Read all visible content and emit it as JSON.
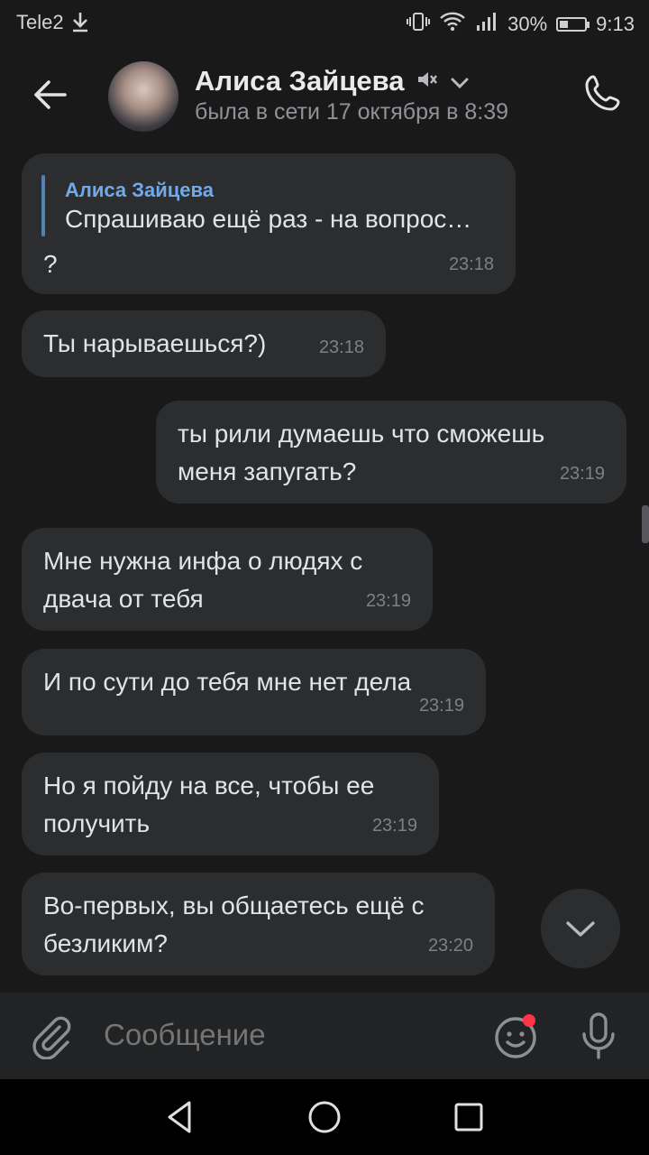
{
  "status_bar": {
    "carrier": "Tele2",
    "battery": "30%",
    "time": "9:13"
  },
  "header": {
    "name": "Алиса Зайцева",
    "status": "была в сети 17 октября в 8:39",
    "icons": [
      "back-arrow-icon",
      "muted-icon",
      "chevron-down-icon",
      "phone-icon"
    ]
  },
  "messages": [
    {
      "reply": {
        "author": "Алиса Зайцева",
        "text": "Спрашиваю ещё раз - на вопрос…"
      },
      "text": "?",
      "time": "23:18",
      "outgoing": false
    },
    {
      "text": "Ты нарываешься?)",
      "time": "23:18",
      "outgoing": false
    },
    {
      "line1": "ты рили думаешь что сможешь",
      "line2": "меня запугать?",
      "time": "23:19",
      "outgoing": true
    },
    {
      "line1": "Мне нужна инфа о людях с",
      "line2": "двача от тебя",
      "time": "23:19",
      "outgoing": false
    },
    {
      "text": "И по сути до тебя мне нет дела",
      "time": "23:19",
      "outgoing": false
    },
    {
      "line1": "Но я пойду на все, чтобы ее",
      "line2": "получить",
      "time": "23:19",
      "outgoing": false
    },
    {
      "line1": "Во-первых, вы общаетесь ещё с",
      "line2": "безликим?",
      "time": "23:20",
      "outgoing": false
    }
  ],
  "composer": {
    "placeholder": "Сообщение"
  },
  "colors": {
    "background": "#19191a",
    "bubble": "#2c2d2e",
    "accent": "#71aaeb",
    "badge": "#ff3347"
  }
}
